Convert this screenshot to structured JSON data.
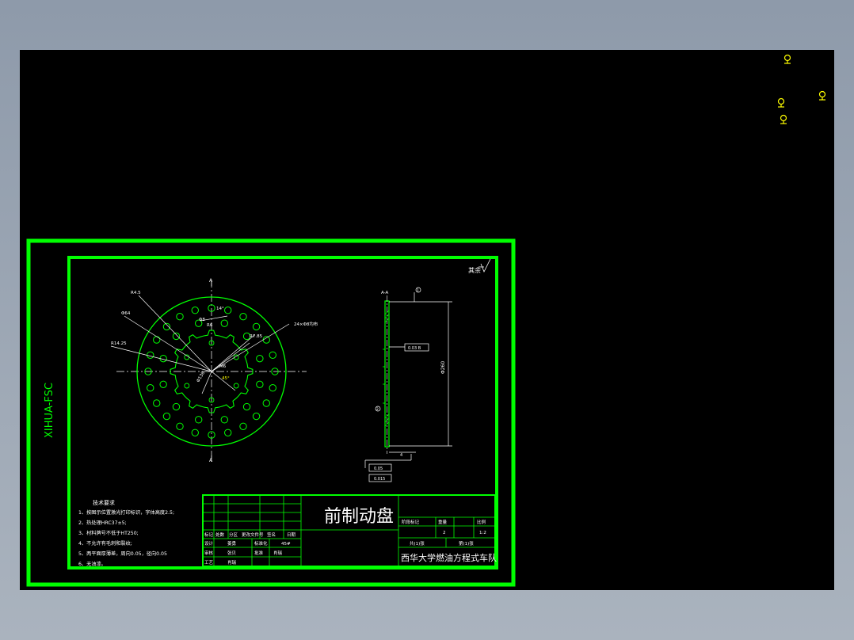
{
  "drawing": {
    "vertical_label": "XIHUA-FSC",
    "roughness_note": "其余",
    "title_block": {
      "part_name": "前制动盘",
      "company": "西华大学燃油方程式车队",
      "header_cells": [
        "标记",
        "处数",
        "分区",
        "更改文件号",
        "签名",
        "日期"
      ],
      "row_labels": [
        "设计",
        "审核",
        "工艺"
      ],
      "row_values": [
        "姜勇",
        "张贝",
        "肖瑞"
      ],
      "mid_labels": [
        "标准化",
        "批准"
      ],
      "mid_values": [
        "45#",
        "肖瑞"
      ],
      "stage_header": [
        "阶段标记",
        "重量",
        "比例"
      ],
      "stage_values": [
        "",
        "2",
        "1:2"
      ],
      "sheet_left": "共(1)张",
      "sheet_right": "第(1)张"
    },
    "tech_requirements": {
      "title": "技术要求",
      "items": [
        "1、按图示位置激光打印标识，字体高度2.5;",
        "2、热处理HRC37±5;",
        "3、材料牌号不低于HT250;",
        "4、不允许有毛刺和裂纹;",
        "5、两平面厚薄差，周向0.05，径向0.05",
        "6、无油漆。"
      ]
    },
    "front_view_labels": [
      "R4.5",
      "Φ64",
      "R14.25",
      "Φ8",
      "R6",
      "14°",
      "24×Φ8均布",
      "R7.85",
      "M6",
      "Φ138",
      "45°",
      "A",
      "A"
    ],
    "side_view_labels": [
      "A-A",
      "Φ260",
      "0.03 B",
      "B",
      "4",
      "0.05",
      "0.015"
    ],
    "markers": [
      "1",
      "2"
    ]
  },
  "colors": {
    "viewport_bg": "#000000",
    "frame_green": "#00ff00",
    "line_white": "#ffffff",
    "marker_yellow": "#ffff00"
  }
}
